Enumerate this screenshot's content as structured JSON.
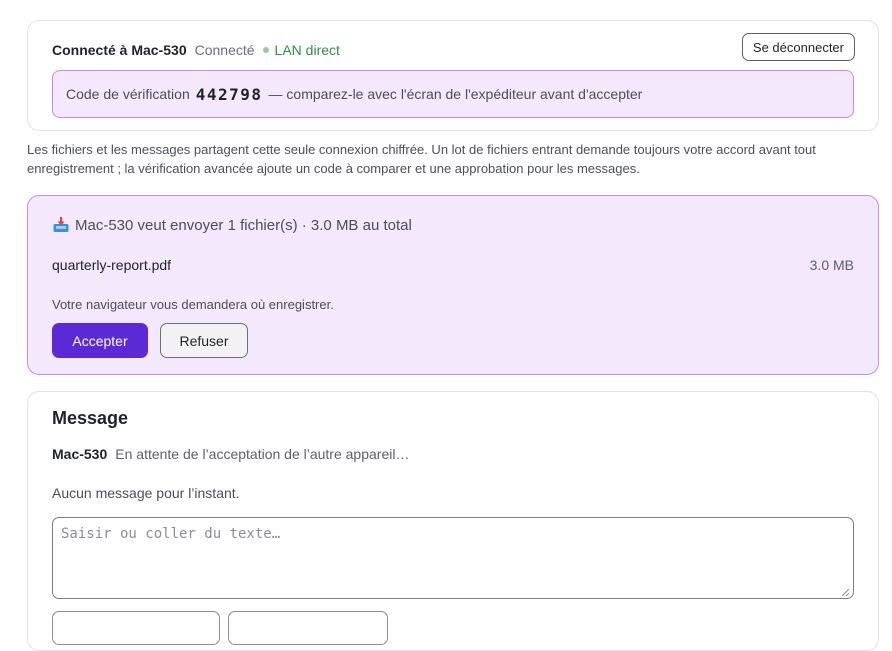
{
  "connection": {
    "title": "Connecté à Mac-530",
    "status": "Connecté",
    "lan_label": "LAN direct",
    "disconnect_label": "Se déconnecter",
    "verification": {
      "prefix": "Code de vérification",
      "code": "442798",
      "suffix": "— comparez-le avec l'écran de l'expéditeur avant d'accepter"
    }
  },
  "info_text": "Les fichiers et les messages partagent cette seule connexion chiffrée. Un lot de fichiers entrant demande toujours votre accord avant tout enregistrement ; la vérification avancée ajoute un code à comparer et une approbation pour les messages.",
  "incoming": {
    "icon": "inbox-tray-icon",
    "title": "Mac-530 veut envoyer 1 fichier(s) · 3.0 MB au total",
    "files": [
      {
        "name": "quarterly-report.pdf",
        "size": "3.0 MB"
      }
    ],
    "browser_note": "Votre navigateur vous demandera où enregistrer.",
    "accept_label": "Accepter",
    "refuse_label": "Refuser"
  },
  "message": {
    "heading": "Message",
    "peer_name": "Mac-530",
    "peer_status": "En attente de l’acceptation de l’autre appareil…",
    "empty_text": "Aucun message pour l’instant.",
    "input_placeholder": "Saisir ou coller du texte…",
    "input_value": ""
  },
  "colors": {
    "accent": "#5b2ad6",
    "highlight_bg": "#f4e8fd",
    "highlight_border": "#c987ee",
    "lan_green": "#2f8f46"
  }
}
